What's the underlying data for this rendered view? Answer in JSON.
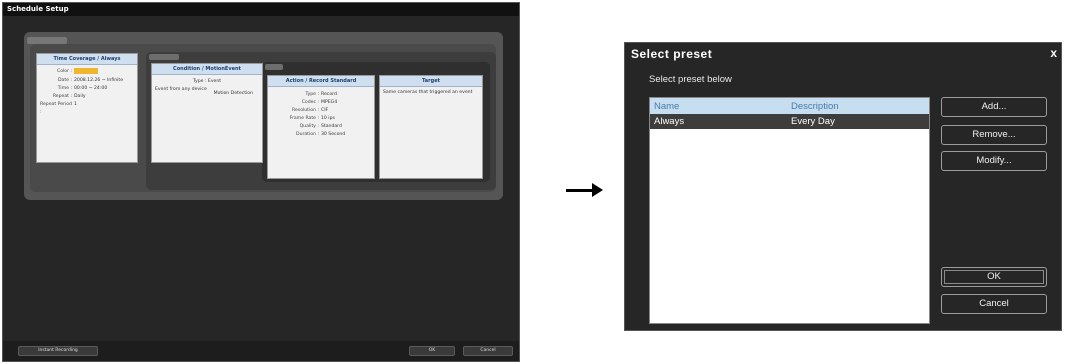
{
  "schedule_window": {
    "title": "Schedule Setup",
    "time_card": {
      "header": "Time Coverage / Always",
      "rows": [
        {
          "k": "Color :",
          "v": ""
        },
        {
          "k": "Date :",
          "v": "2008.12.26 ~ Infinite"
        },
        {
          "k": "Time :",
          "v": "00:00 ~ 24:00"
        },
        {
          "k": "Repeat :",
          "v": "Daily"
        },
        {
          "k": "Repeat Period :",
          "v": "1"
        }
      ],
      "color_value": "#f1b52f"
    },
    "condition_card": {
      "header": "Condition / MotionEvent",
      "type_line": "Type : Event",
      "event_line_1": "Event from any device",
      "event_line_2": "Motion Detection"
    },
    "action_card": {
      "header": "Action / Record Standard",
      "rows": [
        {
          "k": "Type :",
          "v": "Record"
        },
        {
          "k": "Codec :",
          "v": "MPEG4"
        },
        {
          "k": "Resolution :",
          "v": "CIF"
        },
        {
          "k": "Frame Rate :",
          "v": "10 ips"
        },
        {
          "k": "Quality :",
          "v": "Standard"
        },
        {
          "k": "Duration :",
          "v": "30 Second"
        }
      ]
    },
    "target_card": {
      "header": "Target",
      "text": "Same cameras that triggered an event"
    },
    "buttons": {
      "instant": "Instant Recording",
      "ok": "OK",
      "cancel": "Cancel"
    }
  },
  "preset_dialog": {
    "title": "Select preset",
    "close": "x",
    "subtitle": "Select preset below",
    "columns": [
      "Name",
      "Description"
    ],
    "rows": [
      {
        "name": "Always",
        "description": "Every Day"
      }
    ],
    "buttons": {
      "add": "Add...",
      "remove": "Remove...",
      "modify": "Modify...",
      "ok": "OK",
      "cancel": "Cancel"
    }
  }
}
